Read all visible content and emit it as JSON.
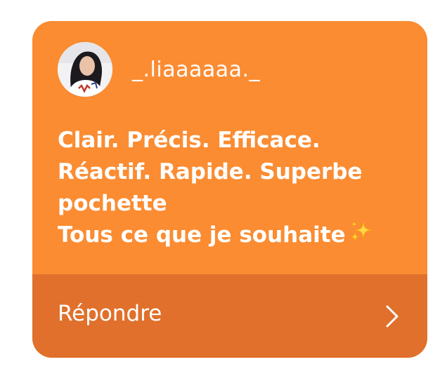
{
  "card": {
    "background_color": "#FB8C32",
    "footer_color": "#E0702B"
  },
  "author": {
    "username": "_.liaaaaaa._",
    "avatar": "profile-photo"
  },
  "message": {
    "lines": [
      "Clair. Précis. Efficace.",
      "Réactif. Rapide.  Superbe",
      "pochette",
      "Tous ce que je souhaite"
    ],
    "trailing_emoji": "sparkles-icon"
  },
  "reply": {
    "label": "Répondre",
    "icon": "chevron-right-icon"
  }
}
